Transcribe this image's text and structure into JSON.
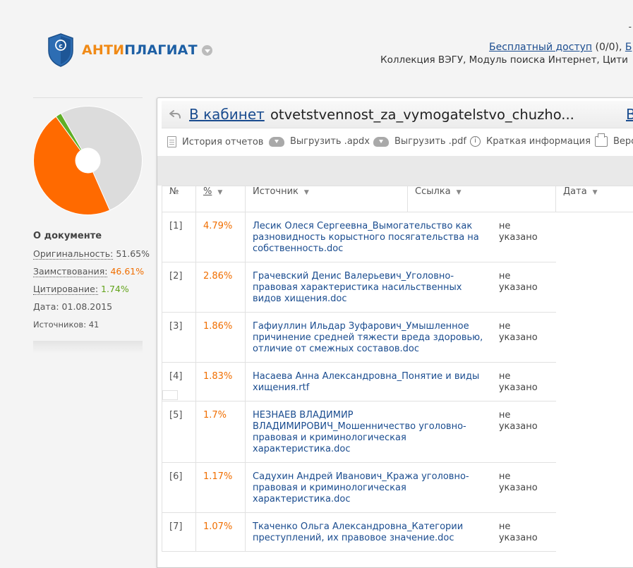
{
  "header": {
    "logo": {
      "part1": "АНТИ",
      "part2": "ПЛАГИАТ"
    },
    "top_dash": "-",
    "free_access_link": "Бесплатный доступ",
    "free_access_count": "(0/0),",
    "next_link_fragment": "Б",
    "collection": "Коллекция ВЭГУ, Модуль поиска Интернет, Цити"
  },
  "sidebar": {
    "about_title": "О документе",
    "originality": {
      "label": "Оригинальность:",
      "value": "51.65%"
    },
    "borrowing": {
      "label": "Заимствования:",
      "value": "46.61%"
    },
    "citation": {
      "label": "Цитирование:",
      "value": "1.74%"
    },
    "date": "Дата: 01.08.2015",
    "sources": "Источников: 41",
    "pie": {
      "slices": [
        {
          "name": "Оригинальность",
          "value": 51.65,
          "color": "#dcdcdc"
        },
        {
          "name": "Заимствования",
          "value": 46.61,
          "color": "#ff6a00"
        },
        {
          "name": "Цитирование",
          "value": 1.74,
          "color": "#5fae26"
        }
      ]
    }
  },
  "panel": {
    "back_link": "В кабинет",
    "doc_name": "otvetstvennost_za_vymogatelstvo_chuzho...",
    "right_link_fragment": "В",
    "toolbar": [
      {
        "icon": "document-icon",
        "label": "История отчетов"
      },
      {
        "icon": "cloud-download-icon",
        "label": "Выгрузить .apdx"
      },
      {
        "icon": "cloud-download-icon",
        "label": "Выгрузить .pdf"
      },
      {
        "icon": "info-icon",
        "label": "Краткая информация"
      },
      {
        "icon": "printer-icon",
        "label": "Верс"
      }
    ],
    "table": {
      "headers": [
        "№",
        "%",
        "Источник",
        "Ссылка",
        "Дата"
      ],
      "rows": [
        {
          "num": "[1]",
          "pct": "4.79%",
          "source": "Лесик Олеся Сергеевна_Вымогательство как разновидность корыстного посягательства на собственность.doc",
          "link": "не указано"
        },
        {
          "num": "[2]",
          "pct": "2.86%",
          "source": "Грачевский Денис Валерьевич_Уголовно-правовая характеристика насильственных видов хищения.doc",
          "link": "не указано"
        },
        {
          "num": "[3]",
          "pct": "1.86%",
          "source": "Гафиуллин Ильдар Зуфарович_Умышленное причинение средней тяжести вреда здоровью, отличие от смежных составов.doc",
          "link": "не указано"
        },
        {
          "num": "[4]",
          "pct": "1.83%",
          "source": "Насаева Анна Александровна_Понятие и виды хищения.rtf",
          "link": "не указано"
        },
        {
          "num": "[5]",
          "pct": "1.7%",
          "source": "НЕЗНАЕВ ВЛАДИМИР ВЛАДИМИРОВИЧ_Мошенничество уголовно-правовая и криминологическая характеристика.doc",
          "link": "не указано"
        },
        {
          "num": "[6]",
          "pct": "1.17%",
          "source": "Садухин Андрей Иванович_Кража уголовно-правовая и криминологическая характеристика.doc",
          "link": "не указано"
        },
        {
          "num": "[7]",
          "pct": "1.07%",
          "source": "Ткаченко Ольга Александровна_Категории преступлений, их правовое значение.doc",
          "link": "не указано"
        }
      ]
    }
  }
}
